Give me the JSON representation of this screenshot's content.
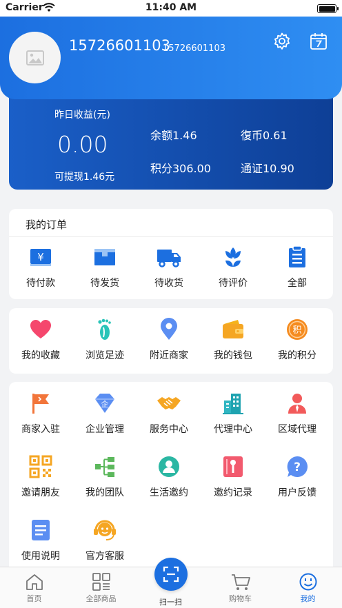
{
  "status_bar": {
    "carrier": "Carrier",
    "time": "11:40 AM"
  },
  "header": {
    "phone_large": "15726601103",
    "phone_small": "15726601103"
  },
  "earnings": {
    "label": "昨日收益(元)",
    "amount": "0.00",
    "withdraw": "可提现1.46元",
    "balance": "余额1.46",
    "coins": "復币0.61",
    "points": "积分306.00",
    "voucher": "通证10.90"
  },
  "orders": {
    "title": "我的订单",
    "items": [
      {
        "label": "待付款",
        "icon": "pending-payment-icon"
      },
      {
        "label": "待发货",
        "icon": "pending-shipment-icon"
      },
      {
        "label": "待收货",
        "icon": "delivery-truck-icon"
      },
      {
        "label": "待评价",
        "icon": "review-flower-icon"
      },
      {
        "label": "全部",
        "icon": "clipboard-icon"
      }
    ]
  },
  "quick": {
    "items": [
      {
        "label": "我的收藏",
        "icon": "heart-icon"
      },
      {
        "label": "浏览足迹",
        "icon": "footprint-icon"
      },
      {
        "label": "附近商家",
        "icon": "location-pin-icon"
      },
      {
        "label": "我的钱包",
        "icon": "wallet-icon"
      },
      {
        "label": "我的积分",
        "icon": "points-icon"
      }
    ],
    "points_glyph": "积"
  },
  "services": {
    "items": [
      {
        "label": "商家入驻",
        "icon": "flag-icon"
      },
      {
        "label": "企业管理",
        "icon": "enterprise-diamond-icon"
      },
      {
        "label": "服务中心",
        "icon": "handshake-icon"
      },
      {
        "label": "代理中心",
        "icon": "buildings-icon"
      },
      {
        "label": "区域代理",
        "icon": "agent-person-icon"
      },
      {
        "label": "邀请朋友",
        "icon": "qr-code-icon"
      },
      {
        "label": "我的团队",
        "icon": "team-tree-icon"
      },
      {
        "label": "生活邀约",
        "icon": "life-invite-icon"
      },
      {
        "label": "邀约记录",
        "icon": "invite-record-icon"
      },
      {
        "label": "用户反馈",
        "icon": "feedback-icon"
      },
      {
        "label": "使用说明",
        "icon": "document-icon"
      },
      {
        "label": "官方客服",
        "icon": "headset-icon"
      }
    ],
    "enterprise_glyph": "企"
  },
  "tabbar": {
    "tabs": [
      {
        "label": "首页",
        "icon": "home-icon"
      },
      {
        "label": "全部商品",
        "icon": "grid-icon"
      },
      {
        "label": "扫一扫",
        "icon": "scan-icon"
      },
      {
        "label": "购物车",
        "icon": "cart-icon"
      },
      {
        "label": "我的",
        "icon": "smile-icon"
      }
    ]
  },
  "colors": {
    "brand_blue": "#1c6fe0",
    "active_tab": "#1c6fe0"
  }
}
